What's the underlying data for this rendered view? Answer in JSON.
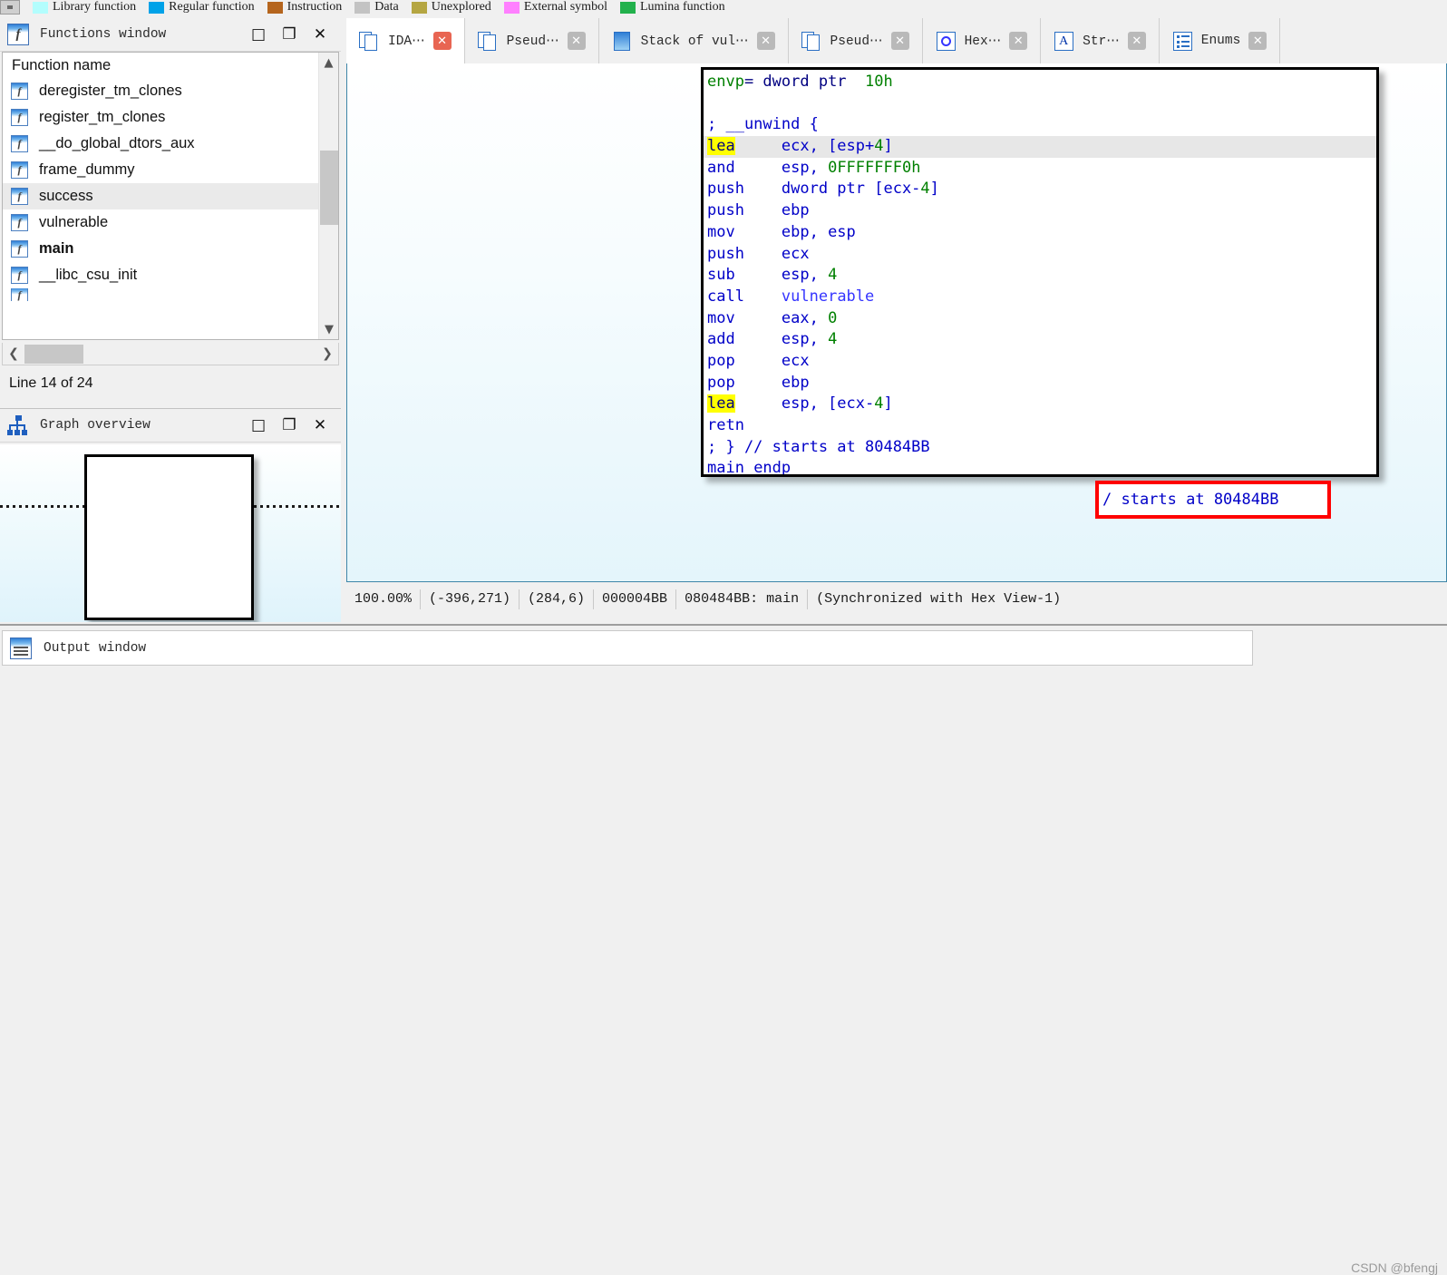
{
  "legend": {
    "items": [
      {
        "label": "Library function",
        "color": "#b3fdfd"
      },
      {
        "label": "Regular function",
        "color": "#00a2e8"
      },
      {
        "label": "Instruction",
        "color": "#b5651d"
      },
      {
        "label": "Data",
        "color": "#c3c3c3"
      },
      {
        "label": "Unexplored",
        "color": "#b5a642"
      },
      {
        "label": "External symbol",
        "color": "#ff80ff"
      },
      {
        "label": "Lumina function",
        "color": "#22b14c"
      }
    ]
  },
  "functions_window": {
    "title": "Functions window",
    "icon": "function-icon",
    "column_header": "Function name",
    "items": [
      {
        "name": "deregister_tm_clones",
        "selected": false,
        "bold": false
      },
      {
        "name": "register_tm_clones",
        "selected": false,
        "bold": false
      },
      {
        "name": "__do_global_dtors_aux",
        "selected": false,
        "bold": false
      },
      {
        "name": "frame_dummy",
        "selected": false,
        "bold": false
      },
      {
        "name": "success",
        "selected": true,
        "bold": false
      },
      {
        "name": "vulnerable",
        "selected": false,
        "bold": false
      },
      {
        "name": "main",
        "selected": false,
        "bold": true
      },
      {
        "name": "__libc_csu_init",
        "selected": false,
        "bold": false
      }
    ],
    "line_status": "Line 14 of 24",
    "window_buttons": {
      "maximize": "□",
      "restore": "❐",
      "close": "✕"
    }
  },
  "graph_overview": {
    "title": "Graph overview",
    "icon": "graph-tree-icon",
    "window_buttons": {
      "maximize": "□",
      "restore": "❐",
      "close": "✕"
    }
  },
  "tabs": [
    {
      "label": "IDA⋯",
      "icon": "ida-view-icon",
      "active": true,
      "close_style": "red"
    },
    {
      "label": "Pseud⋯",
      "icon": "pseudocode-icon",
      "active": false,
      "close_style": "gray"
    },
    {
      "label": "Stack of vul⋯",
      "icon": "stack-icon",
      "active": false,
      "close_style": "gray"
    },
    {
      "label": "Pseud⋯",
      "icon": "pseudocode-icon",
      "active": false,
      "close_style": "gray"
    },
    {
      "label": "Hex⋯",
      "icon": "hex-view-icon",
      "active": false,
      "close_style": "gray"
    },
    {
      "label": "Str⋯",
      "icon": "strings-icon",
      "active": false,
      "close_style": "gray"
    },
    {
      "label": "Enums",
      "icon": "enums-icon",
      "active": false,
      "close_style": "gray"
    }
  ],
  "disassembly": {
    "lines": [
      {
        "id": "l0",
        "text": "envp= dword ptr  10h",
        "highlight": false
      },
      {
        "id": "l1",
        "text": "",
        "highlight": false
      },
      {
        "id": "l2",
        "text": "; __unwind {",
        "highlight": false
      },
      {
        "id": "l3",
        "text": "lea     ecx, [esp+4]",
        "highlight": true
      },
      {
        "id": "l4",
        "text": "and     esp, 0FFFFFFF0h",
        "highlight": false
      },
      {
        "id": "l5",
        "text": "push    dword ptr [ecx-4]",
        "highlight": false
      },
      {
        "id": "l6",
        "text": "push    ebp",
        "highlight": false
      },
      {
        "id": "l7",
        "text": "mov     ebp, esp",
        "highlight": false
      },
      {
        "id": "l8",
        "text": "push    ecx",
        "highlight": false
      },
      {
        "id": "l9",
        "text": "sub     esp, 4",
        "highlight": false
      },
      {
        "id": "l10",
        "text": "call    vulnerable",
        "highlight": false
      },
      {
        "id": "l11",
        "text": "mov     eax, 0",
        "highlight": false
      },
      {
        "id": "l12",
        "text": "add     esp, 4",
        "highlight": false
      },
      {
        "id": "l13",
        "text": "pop     ecx",
        "highlight": false
      },
      {
        "id": "l14",
        "text": "pop     ebp",
        "highlight": false
      },
      {
        "id": "l15",
        "text": "lea     esp, [ecx-4]",
        "highlight": false
      },
      {
        "id": "l16",
        "text": "retn",
        "highlight": false
      },
      {
        "id": "l17",
        "text": "; } // starts at 80484BB",
        "highlight": false
      },
      {
        "id": "l18",
        "text": "main endp",
        "highlight": false
      }
    ],
    "annotation": {
      "text": "/ starts at 80484BB",
      "border_color": "#ff0000"
    }
  },
  "status_bar": {
    "zoom": "100.00%",
    "graph_coords": "(-396,271)",
    "cursor_coords": "(284,6)",
    "file_offset": "000004BB",
    "address": "080484BB: main",
    "sync": "(Synchronized with Hex View-1)"
  },
  "output_window": {
    "title": "Output window",
    "icon": "output-lines-icon"
  },
  "watermark": "CSDN @bfengj"
}
